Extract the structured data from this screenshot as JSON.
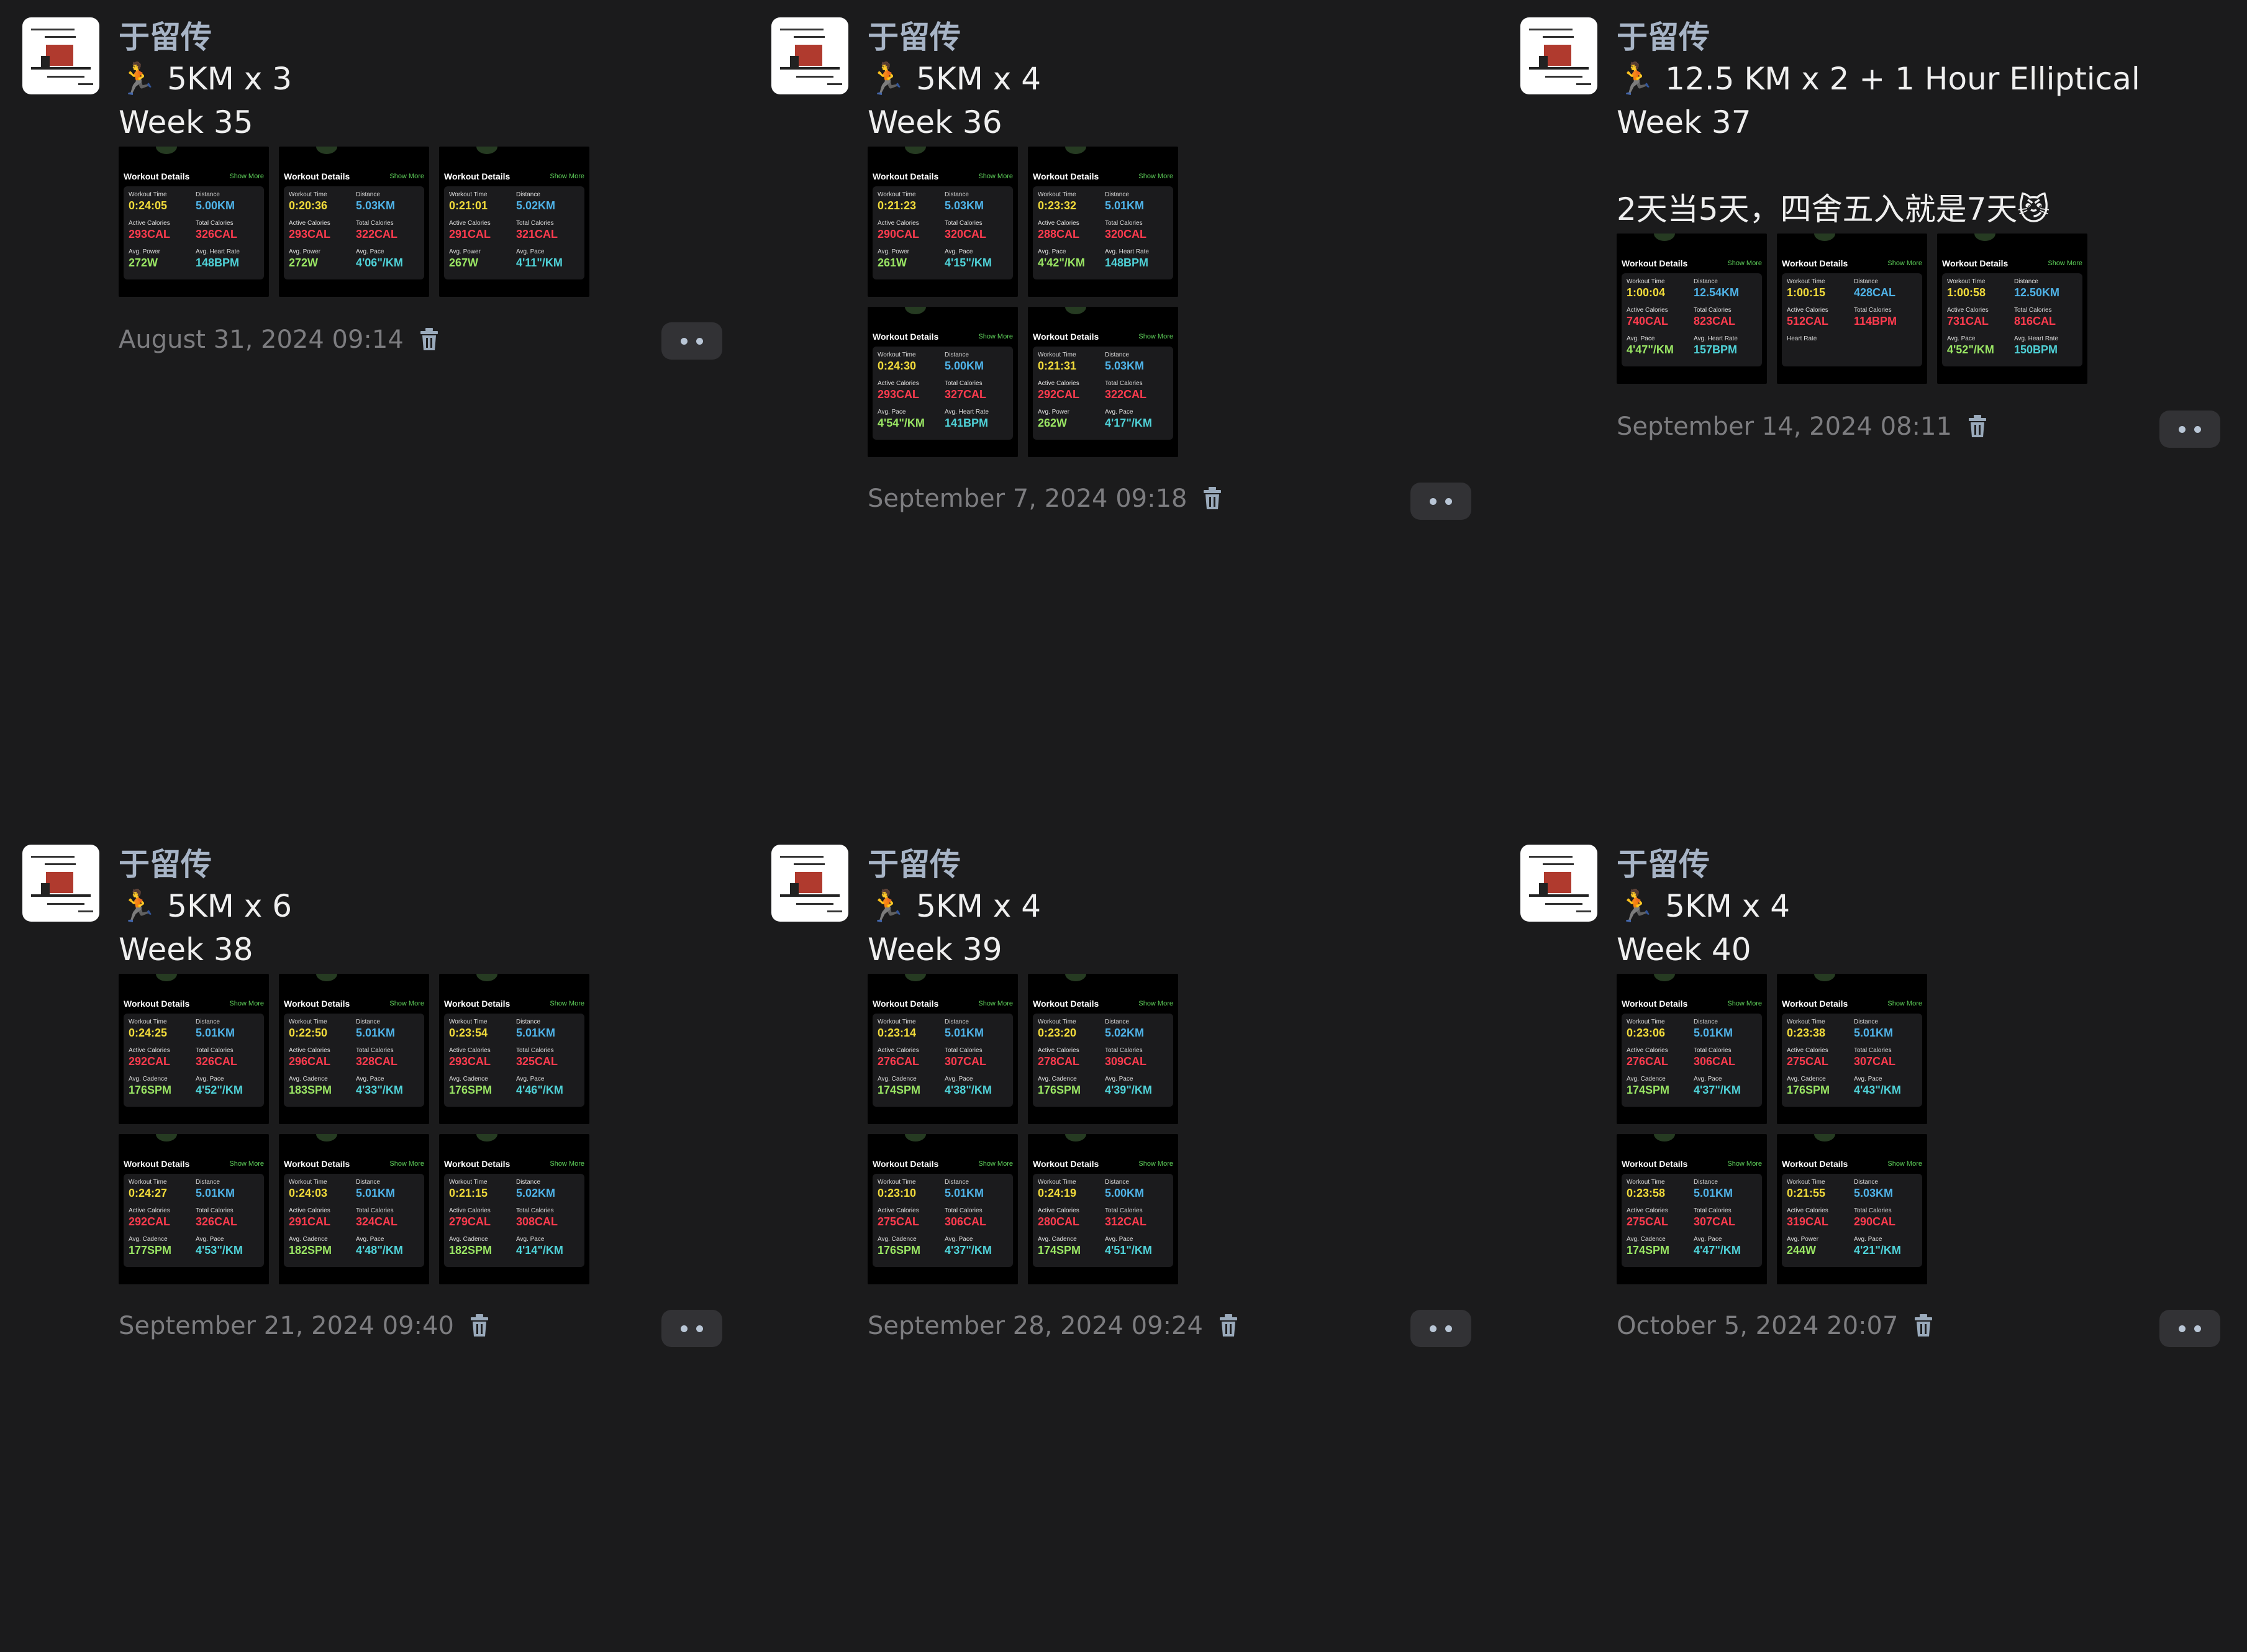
{
  "theme": {
    "background": "#1b1b1c",
    "author_color": "#a7b4c6",
    "meta_color": "#7d7d80"
  },
  "posts": [
    {
      "author": "于留传",
      "lines": [
        "🏃 5KM x 3",
        "Week 35"
      ],
      "photos": [
        {
          "header": "Workout Details",
          "show_more": "Show More",
          "time": "0:24:05",
          "distance": "5.00KM",
          "active": "293CAL",
          "total": "326CAL",
          "k3": "Avg. Power",
          "v3": "272W",
          "k4": "Avg. Heart Rate",
          "v4": "148BPM"
        },
        {
          "header": "Workout Details",
          "show_more": "Show More",
          "time": "0:20:36",
          "distance": "5.03KM",
          "active": "293CAL",
          "total": "322CAL",
          "k3": "Avg. Power",
          "v3": "272W",
          "k4": "Avg. Pace",
          "v4": "4'06\"/KM"
        },
        {
          "header": "Workout Details",
          "show_more": "Show More",
          "time": "0:21:01",
          "distance": "5.02KM",
          "active": "291CAL",
          "total": "321CAL",
          "k3": "Avg. Power",
          "v3": "267W",
          "k4": "Avg. Pace",
          "v4": "4'11\"/KM"
        }
      ],
      "timestamp": "August 31, 2024 09:14"
    },
    {
      "author": "于留传",
      "lines": [
        "🏃 5KM x 4",
        "Week 36"
      ],
      "photos": [
        {
          "header": "Workout Details",
          "show_more": "Show More",
          "time": "0:21:23",
          "distance": "5.03KM",
          "active": "290CAL",
          "total": "320CAL",
          "k3": "Avg. Power",
          "v3": "261W",
          "k4": "Avg. Pace",
          "v4": "4'15\"/KM"
        },
        {
          "header": "Workout Details",
          "show_more": "Show More",
          "time": "0:23:32",
          "distance": "5.01KM",
          "active": "288CAL",
          "total": "320CAL",
          "k3": "Avg. Pace",
          "v3": "4'42\"/KM",
          "k4": "Avg. Heart Rate",
          "v4": "148BPM"
        },
        {
          "header": "Workout Details",
          "show_more": "Show More",
          "time": "0:24:30",
          "distance": "5.00KM",
          "active": "293CAL",
          "total": "327CAL",
          "k3": "Avg. Pace",
          "v3": "4'54\"/KM",
          "k4": "Avg. Heart Rate",
          "v4": "141BPM"
        },
        {
          "header": "Workout Details",
          "show_more": "Show More",
          "time": "0:21:31",
          "distance": "5.03KM",
          "active": "292CAL",
          "total": "322CAL",
          "k3": "Avg. Power",
          "v3": "262W",
          "k4": "Avg. Pace",
          "v4": "4'17\"/KM"
        }
      ],
      "timestamp": "September 7, 2024 09:18"
    },
    {
      "author": "于留传",
      "lines": [
        "🏃 12.5 KM x 2 + 1 Hour Elliptical",
        "Week 37",
        "",
        "2天当5天，四舍五入就是7天😼"
      ],
      "photos": [
        {
          "header": "Workout Details",
          "show_more": "Show More",
          "time": "1:00:04",
          "distance": "12.54KM",
          "active": "740CAL",
          "total": "823CAL",
          "k3": "Avg. Pace",
          "v3": "4'47\"/KM",
          "k4": "Avg. Heart Rate",
          "v4": "157BPM"
        },
        {
          "header": "Workout Details",
          "show_more": "Show More",
          "time": "1:00:15",
          "distance": "428CAL",
          "active": "512CAL",
          "total": "114BPM",
          "k3": "Heart Rate",
          "v3": "",
          "k4": "",
          "v4": ""
        },
        {
          "header": "Workout Details",
          "show_more": "Show More",
          "time": "1:00:58",
          "distance": "12.50KM",
          "active": "731CAL",
          "total": "816CAL",
          "k3": "Avg. Pace",
          "v3": "4'52\"/KM",
          "k4": "Avg. Heart Rate",
          "v4": "150BPM"
        }
      ],
      "timestamp": "September 14, 2024 08:11"
    },
    {
      "author": "于留传",
      "lines": [
        "🏃 5KM x 6",
        "Week 38"
      ],
      "photos": [
        {
          "header": "Workout Details",
          "show_more": "Show More",
          "time": "0:24:25",
          "distance": "5.01KM",
          "active": "292CAL",
          "total": "326CAL",
          "k3": "Avg. Cadence",
          "v3": "176SPM",
          "k4": "Avg. Pace",
          "v4": "4'52\"/KM"
        },
        {
          "header": "Workout Details",
          "show_more": "Show More",
          "time": "0:22:50",
          "distance": "5.01KM",
          "active": "296CAL",
          "total": "328CAL",
          "k3": "Avg. Cadence",
          "v3": "183SPM",
          "k4": "Avg. Pace",
          "v4": "4'33\"/KM"
        },
        {
          "header": "Workout Details",
          "show_more": "Show More",
          "time": "0:23:54",
          "distance": "5.01KM",
          "active": "293CAL",
          "total": "325CAL",
          "k3": "Avg. Cadence",
          "v3": "176SPM",
          "k4": "Avg. Pace",
          "v4": "4'46\"/KM"
        },
        {
          "header": "Workout Details",
          "show_more": "Show More",
          "time": "0:24:27",
          "distance": "5.01KM",
          "active": "292CAL",
          "total": "326CAL",
          "k3": "Avg. Cadence",
          "v3": "177SPM",
          "k4": "Avg. Pace",
          "v4": "4'53\"/KM"
        },
        {
          "header": "Workout Details",
          "show_more": "Show More",
          "time": "0:24:03",
          "distance": "5.01KM",
          "active": "291CAL",
          "total": "324CAL",
          "k3": "Avg. Cadence",
          "v3": "182SPM",
          "k4": "Avg. Pace",
          "v4": "4'48\"/KM"
        },
        {
          "header": "Workout Details",
          "show_more": "Show More",
          "time": "0:21:15",
          "distance": "5.02KM",
          "active": "279CAL",
          "total": "308CAL",
          "k3": "Avg. Cadence",
          "v3": "182SPM",
          "k4": "Avg. Pace",
          "v4": "4'14\"/KM"
        }
      ],
      "timestamp": "September 21, 2024 09:40"
    },
    {
      "author": "于留传",
      "lines": [
        "🏃 5KM x 4",
        "Week 39"
      ],
      "photos": [
        {
          "header": "Workout Details",
          "show_more": "Show More",
          "time": "0:23:14",
          "distance": "5.01KM",
          "active": "276CAL",
          "total": "307CAL",
          "k3": "Avg. Cadence",
          "v3": "174SPM",
          "k4": "Avg. Pace",
          "v4": "4'38\"/KM"
        },
        {
          "header": "Workout Details",
          "show_more": "Show More",
          "time": "0:23:20",
          "distance": "5.02KM",
          "active": "278CAL",
          "total": "309CAL",
          "k3": "Avg. Cadence",
          "v3": "176SPM",
          "k4": "Avg. Pace",
          "v4": "4'39\"/KM"
        },
        {
          "header": "Workout Details",
          "show_more": "Show More",
          "time": "0:23:10",
          "distance": "5.01KM",
          "active": "275CAL",
          "total": "306CAL",
          "k3": "Avg. Cadence",
          "v3": "176SPM",
          "k4": "Avg. Pace",
          "v4": "4'37\"/KM"
        },
        {
          "header": "Workout Details",
          "show_more": "Show More",
          "time": "0:24:19",
          "distance": "5.00KM",
          "active": "280CAL",
          "total": "312CAL",
          "k3": "Avg. Cadence",
          "v3": "174SPM",
          "k4": "Avg. Pace",
          "v4": "4'51\"/KM"
        }
      ],
      "timestamp": "September 28, 2024 09:24"
    },
    {
      "author": "于留传",
      "lines": [
        "🏃 5KM x 4",
        "Week 40"
      ],
      "photos": [
        {
          "header": "Workout Details",
          "show_more": "Show More",
          "time": "0:23:06",
          "distance": "5.01KM",
          "active": "276CAL",
          "total": "306CAL",
          "k3": "Avg. Cadence",
          "v3": "174SPM",
          "k4": "Avg. Pace",
          "v4": "4'37\"/KM"
        },
        {
          "header": "Workout Details",
          "show_more": "Show More",
          "time": "0:23:38",
          "distance": "5.01KM",
          "active": "275CAL",
          "total": "307CAL",
          "k3": "Avg. Cadence",
          "v3": "176SPM",
          "k4": "Avg. Pace",
          "v4": "4'43\"/KM"
        },
        {
          "header": "Workout Details",
          "show_more": "Show More",
          "time": "0:23:58",
          "distance": "5.01KM",
          "active": "275CAL",
          "total": "307CAL",
          "k3": "Avg. Cadence",
          "v3": "174SPM",
          "k4": "Avg. Pace",
          "v4": "4'47\"/KM"
        },
        {
          "header": "Workout Details",
          "show_more": "Show More",
          "time": "0:21:55",
          "distance": "5.03KM",
          "active": "319CAL",
          "total": "290CAL",
          "k3": "Avg. Power",
          "v3": "244W",
          "k4": "Avg. Pace",
          "v4": "4'21\"/KM"
        }
      ],
      "timestamp": "October 5, 2024 20:07"
    }
  ],
  "icons": {
    "delete": "trash-icon",
    "more": "more-dots-icon",
    "emoji": "runner-icon"
  }
}
